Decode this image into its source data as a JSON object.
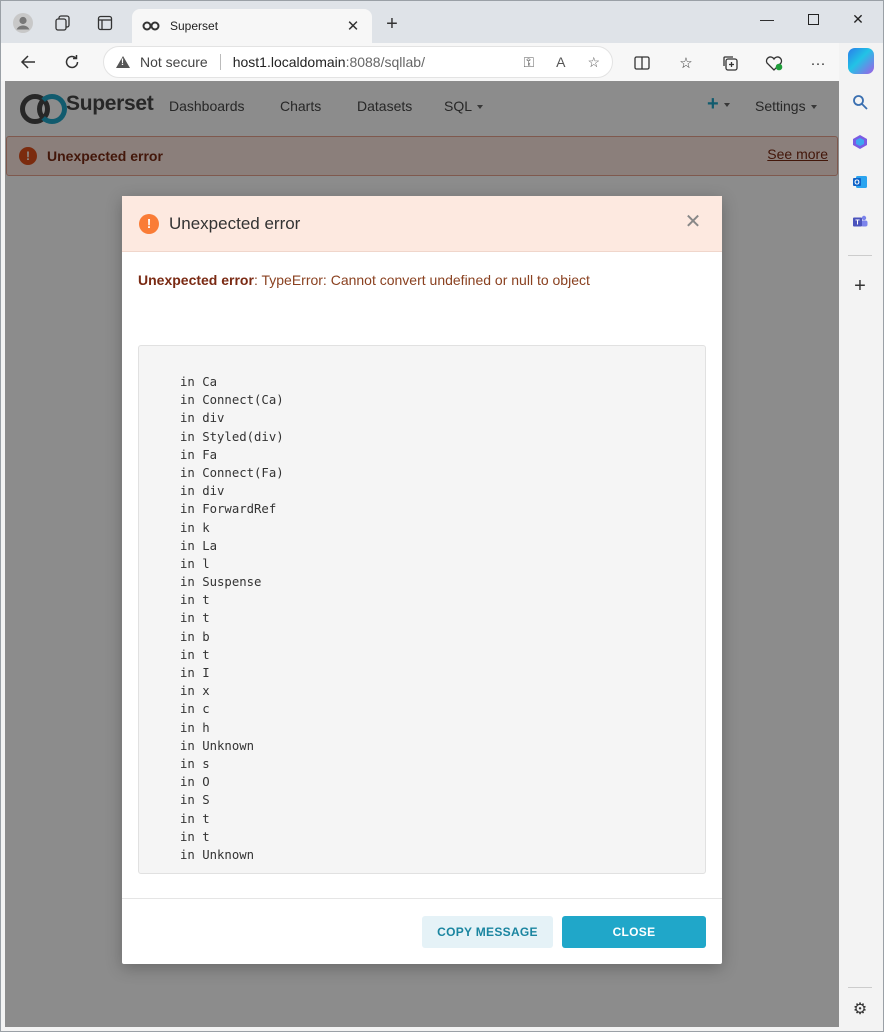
{
  "browser": {
    "tab_title": "Superset",
    "security_label": "Not secure",
    "url_host": "host1.localdomain",
    "url_rest": ":8088/sqllab/"
  },
  "superset_nav": {
    "logo_text": "Superset",
    "items": [
      "Dashboards",
      "Charts",
      "Datasets",
      "SQL"
    ],
    "settings_label": "Settings",
    "plus_label": "+"
  },
  "toast": {
    "text": "Unexpected error",
    "see_more": "See more"
  },
  "modal": {
    "title": "Unexpected error",
    "message_prefix": "Unexpected error",
    "message_body": ": TypeError: Cannot convert undefined or null to object",
    "stack_lines": [
      "in Ca",
      "in Connect(Ca)",
      "in div",
      "in Styled(div)",
      "in Fa",
      "in Connect(Fa)",
      "in div",
      "in ForwardRef",
      "in k",
      "in La",
      "in l",
      "in Suspense",
      "in t",
      "in t",
      "in b",
      "in t",
      "in I",
      "in x",
      "in c",
      "in h",
      "in Unknown",
      "in s",
      "in O",
      "in S",
      "in t",
      "in t",
      "in Unknown"
    ],
    "copy_label": "COPY MESSAGE",
    "close_label": "CLOSE"
  },
  "colors": {
    "brand": "#20a7c9",
    "error": "#e04f1a",
    "warning_icon": "#fa7c36"
  }
}
